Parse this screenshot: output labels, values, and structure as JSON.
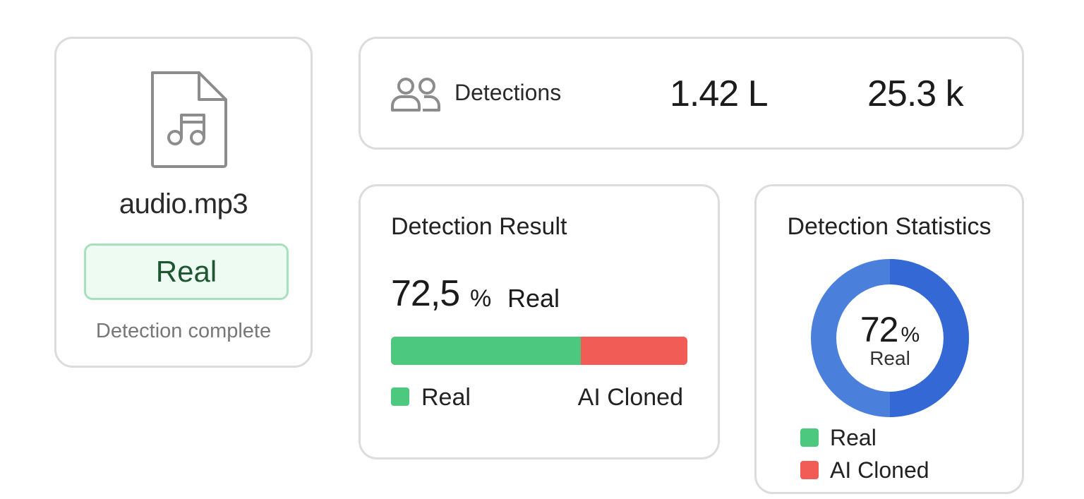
{
  "file": {
    "name": "audio.mp3",
    "icon": "audio-file-icon",
    "status": "Real",
    "status_note": "Detection complete"
  },
  "stats": {
    "icon": "users-icon",
    "label": "Detections",
    "metric_1": "1.42 L",
    "metric_2": "25.3 k"
  },
  "result": {
    "title": "Detection Result",
    "value": "72,5",
    "unit": "%",
    "label": "Real",
    "real_fraction": 0.64,
    "legend_real": "Real",
    "legend_ai": "AI Cloned"
  },
  "statistics": {
    "title": "Detection Statistics",
    "value": "72",
    "unit": "%",
    "label": "Real",
    "legend": [
      {
        "label": "Real",
        "color": "#4cc97e"
      },
      {
        "label": "AI Cloned",
        "color": "#f25c56"
      }
    ]
  },
  "colors": {
    "real": "#4cc97e",
    "ai_cloned": "#f25c56",
    "donut_light": "#4a7fdb",
    "donut_dark": "#3468d4",
    "status_border": "#a7e0bd",
    "status_bg": "#eefbf3"
  }
}
